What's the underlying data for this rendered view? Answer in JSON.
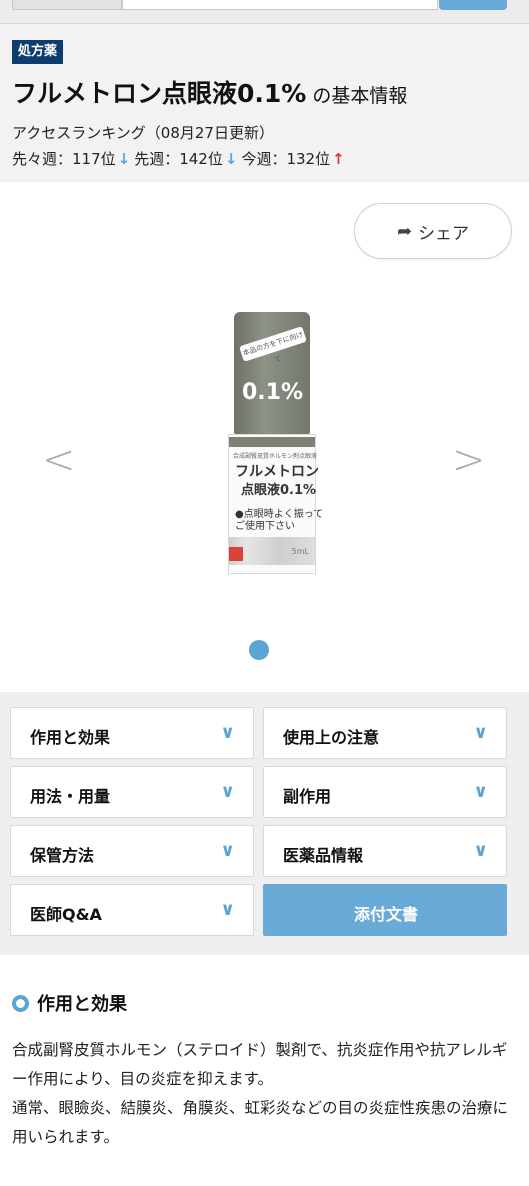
{
  "header": {
    "badge": "処方薬",
    "drug_name": "フルメトロン点眼液0.1%",
    "title_suffix": "の基本情報",
    "ranking_heading": "アクセスランキング（08月27日更新）",
    "ranking": {
      "prev_prev_label": "先々週：117位",
      "prev_label": "先週：142位",
      "current_label": "今週：132位",
      "down_arrow": "↓",
      "up_arrow": "↑"
    }
  },
  "carousel": {
    "share_label": "シェア",
    "prev_glyph": "<",
    "next_glyph": ">",
    "image": {
      "cap_label": "本品の方を下に向けて",
      "cap_percent": "0.1%",
      "small_text": "合成副腎皮質ホルモン剤点眼液",
      "name_line1": "フルメトロン",
      "name_line2": "点眼液0.1%",
      "note_line1": "●点眼時よく振って",
      "note_line2": "ご使用下さい",
      "volume": "5mL"
    }
  },
  "menu": {
    "items": [
      {
        "label": "作用と効果"
      },
      {
        "label": "使用上の注意"
      },
      {
        "label": "用法・用量"
      },
      {
        "label": "副作用"
      },
      {
        "label": "保管方法"
      },
      {
        "label": "医薬品情報"
      },
      {
        "label": "医師Q&A"
      },
      {
        "label": "添付文書"
      }
    ],
    "chevron": "∨"
  },
  "section": {
    "title": "作用と効果",
    "body": "合成副腎皮質ホルモン（ステロイド）製剤で、抗炎症作用や抗アレルギー作用により、目の炎症を抑えます。\n通常、眼瞼炎、結膜炎、角膜炎、虹彩炎などの目の炎症性疾患の治療に用いられます。"
  },
  "colors": {
    "accent": "#5ba4d4",
    "badge_bg": "#0d3d6e",
    "up_arrow": "#e0393c",
    "down_arrow": "#5aa6d6"
  }
}
